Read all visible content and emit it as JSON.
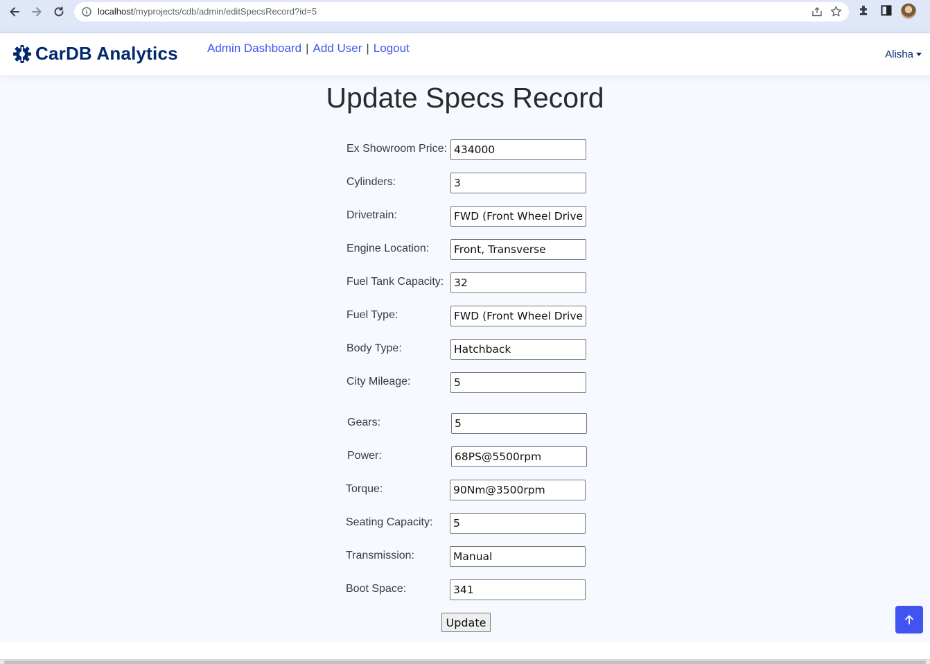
{
  "browser": {
    "url_host": "localhost",
    "url_path": "/myprojects/cdb/admin/editSpecsRecord?id=5",
    "icons": [
      "back-arrow-icon",
      "forward-arrow-icon",
      "reload-icon",
      "info-icon",
      "share-icon",
      "star-icon",
      "puzzle-icon",
      "sidepanel-icon",
      "profile-avatar"
    ]
  },
  "header": {
    "brand": "CarDB Analytics",
    "nav": {
      "dashboard": "Admin Dashboard",
      "sep1": "|",
      "add_user": "Add User",
      "sep2": "|",
      "logout": "Logout"
    },
    "user": "Alisha"
  },
  "page": {
    "title": "Update Specs Record",
    "fields": [
      {
        "label": "Ex Showroom Price:",
        "value": "434000"
      },
      {
        "label": "Cylinders:",
        "value": "3"
      },
      {
        "label": "Drivetrain:",
        "value": "FWD (Front Wheel Drive)"
      },
      {
        "label": "Engine Location:",
        "value": "Front, Transverse"
      },
      {
        "label": "Fuel Tank Capacity:",
        "value": "32"
      },
      {
        "label": "Fuel Type:",
        "value": "FWD (Front Wheel Drive)"
      },
      {
        "label": "Body Type:",
        "value": "Hatchback"
      },
      {
        "label": "City Mileage:",
        "value": "5"
      },
      {
        "label": "Gears:",
        "value": "5"
      },
      {
        "label": "Power:",
        "value": "68PS@5500rpm"
      },
      {
        "label": "Torque:",
        "value": "90Nm@3500rpm"
      },
      {
        "label": "Seating Capacity:",
        "value": "5"
      },
      {
        "label": "Transmission:",
        "value": "Manual"
      },
      {
        "label": "Boot Space:",
        "value": "341"
      }
    ],
    "submit": "Update"
  },
  "colors": {
    "brand": "#012970",
    "link": "#4154f1",
    "page_bg": "#f6f9ff"
  }
}
